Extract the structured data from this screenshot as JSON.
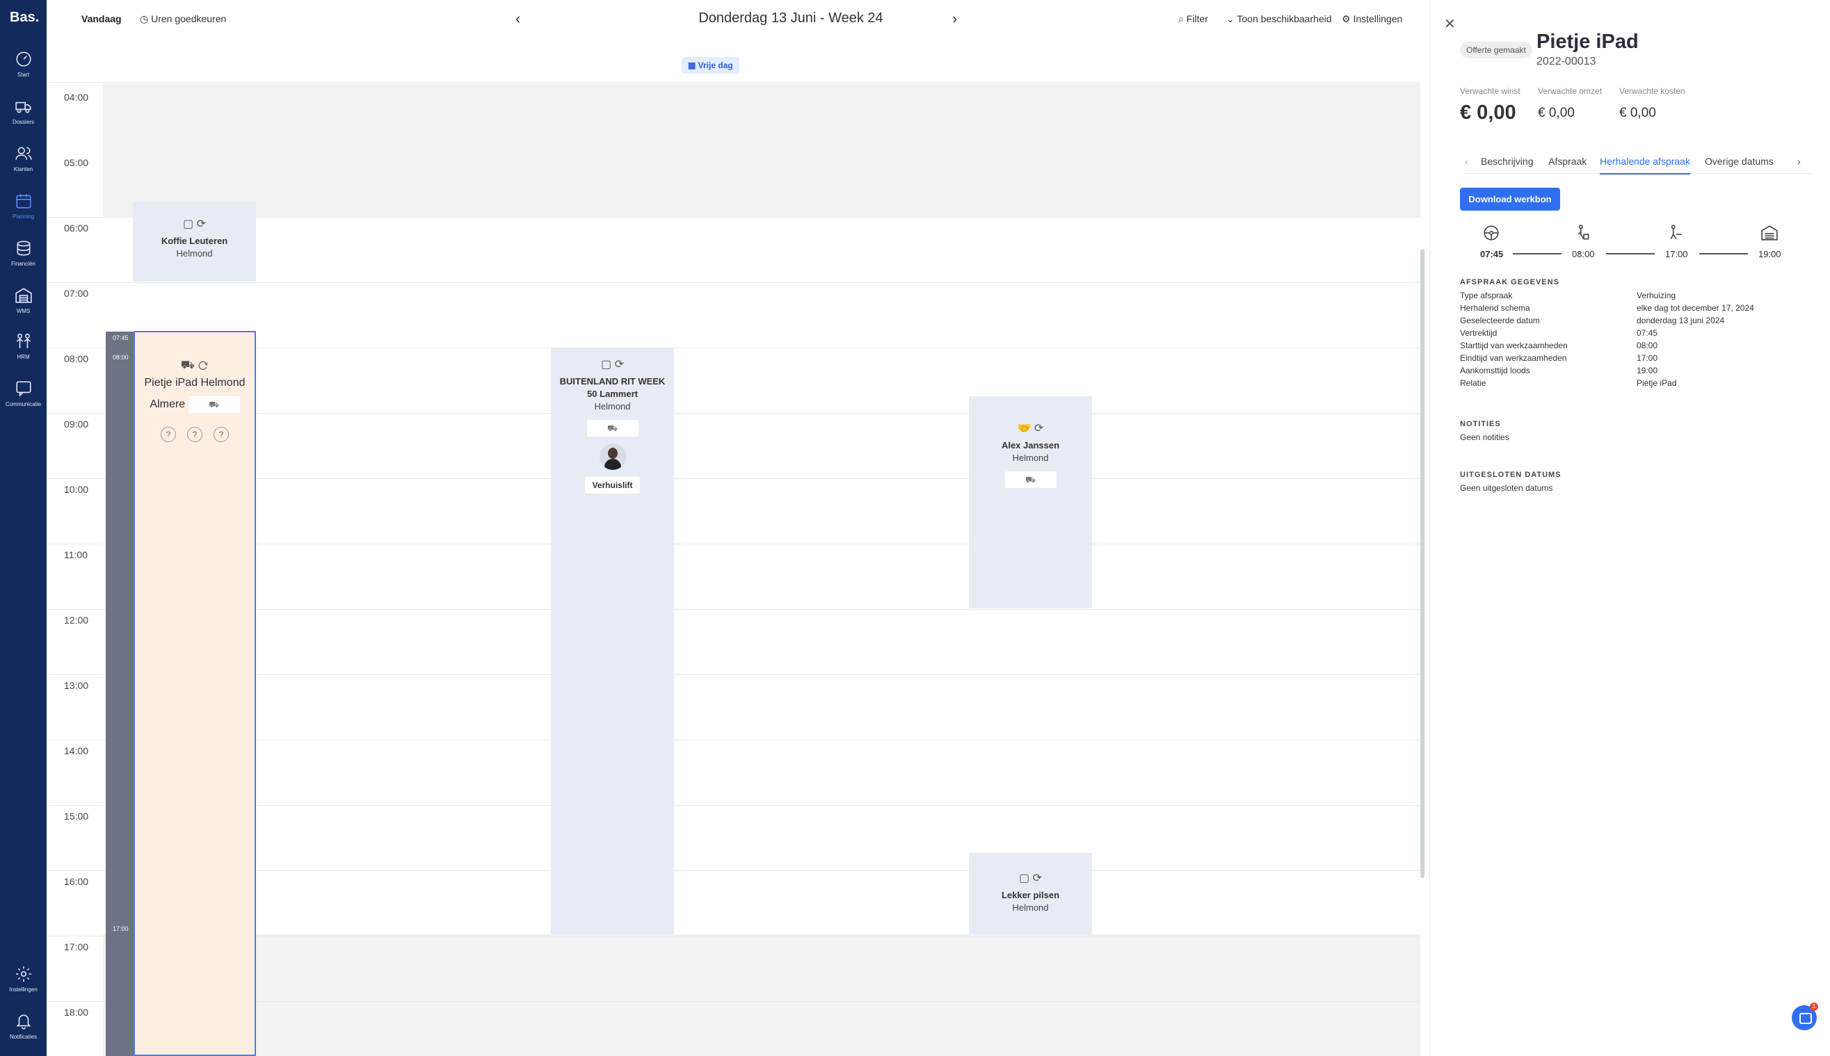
{
  "app": {
    "logo": "Bas."
  },
  "sidebar": {
    "items": [
      {
        "label": "Start",
        "icon": "gauge-icon"
      },
      {
        "label": "Dossiers",
        "icon": "truck-icon"
      },
      {
        "label": "Klanten",
        "icon": "users-icon"
      },
      {
        "label": "Planning",
        "icon": "calendar-icon"
      },
      {
        "label": "Financiën",
        "icon": "coins-icon"
      },
      {
        "label": "WMS",
        "icon": "warehouse-icon"
      },
      {
        "label": "HRM",
        "icon": "people-icon"
      },
      {
        "label": "Communicatie",
        "icon": "chat-icon"
      }
    ],
    "bottom": [
      {
        "label": "Instellingen",
        "icon": "gear-icon"
      },
      {
        "label": "Notificaties",
        "icon": "bell-icon"
      }
    ]
  },
  "topbar": {
    "today": "Vandaag",
    "approve_hours": "Uren goedkeuren",
    "date_title": "Donderdag 13 Juni - Week 24",
    "filter": "Filter",
    "availability": "Toon beschikbaarheid",
    "settings": "Instellingen"
  },
  "planner": {
    "free_day": "Vrije dag",
    "hours": [
      "04:00",
      "05:00",
      "06:00",
      "07:00",
      "08:00",
      "09:00",
      "10:00",
      "11:00",
      "12:00",
      "13:00",
      "14:00",
      "15:00",
      "16:00",
      "17:00",
      "18:00"
    ],
    "bar_times": {
      "depart": "07:45",
      "start": "08:00",
      "end": "17:00"
    },
    "events": [
      {
        "title": "Koffie Leuteren",
        "city": "Helmond"
      },
      {
        "title": "Pietje iPad",
        "city": "Helmond",
        "city2": "Almere"
      },
      {
        "title": "BUITENLAND RIT WEEK 50 Lammert",
        "city": "Helmond",
        "button": "Verhuislift"
      },
      {
        "title": "Alex Janssen",
        "city": "Helmond"
      },
      {
        "title": "Lekker pilsen",
        "city": "Helmond"
      }
    ]
  },
  "panel": {
    "status_badge": "Offerte gemaakt",
    "title": "Pietje iPad",
    "number": "2022-00013",
    "metrics": [
      {
        "label": "Verwachte winst",
        "value": "€ 0,00"
      },
      {
        "label": "Verwachte omzet",
        "value": "€ 0,00"
      },
      {
        "label": "Verwachte kosten",
        "value": "€ 0,00"
      }
    ],
    "tabs": [
      "Beschrijving",
      "Afspraak",
      "Herhalende afspraak",
      "Overige datums"
    ],
    "active_tab": "Herhalende afspraak",
    "download_button": "Download werkbon",
    "timeline": [
      "07:45",
      "08:00",
      "17:00",
      "19:00"
    ],
    "details_heading": "AFSPRAAK GEGEVENS",
    "details": [
      {
        "label": "Type afspraak",
        "value": "Verhuizing"
      },
      {
        "label": "Herhalend schema",
        "value": "elke dag tot december 17, 2024"
      },
      {
        "label": "Geselecteerde datum",
        "value": "donderdag 13 juni 2024"
      },
      {
        "label": "Vertrektijd",
        "value": "07:45"
      },
      {
        "label": "Starttijd van werkzaamheden",
        "value": "08:00"
      },
      {
        "label": "Eindtijd van werkzaamheden",
        "value": "17:00"
      },
      {
        "label": "Aankomsttijd loods",
        "value": "19:00"
      },
      {
        "label": "Relatie",
        "value": "Pietje iPad"
      }
    ],
    "notes_heading": "NOTITIES",
    "notes_value": "Geen notities",
    "excluded_heading": "UITGESLOTEN DATUMS",
    "excluded_value": "Geen uitgesloten datums",
    "chat_unread": "1"
  },
  "colors": {
    "sidebar": "#132a5c",
    "accent": "#2f6ff1",
    "selected_event": "#fdeee2",
    "event": "#e7ebf3"
  }
}
